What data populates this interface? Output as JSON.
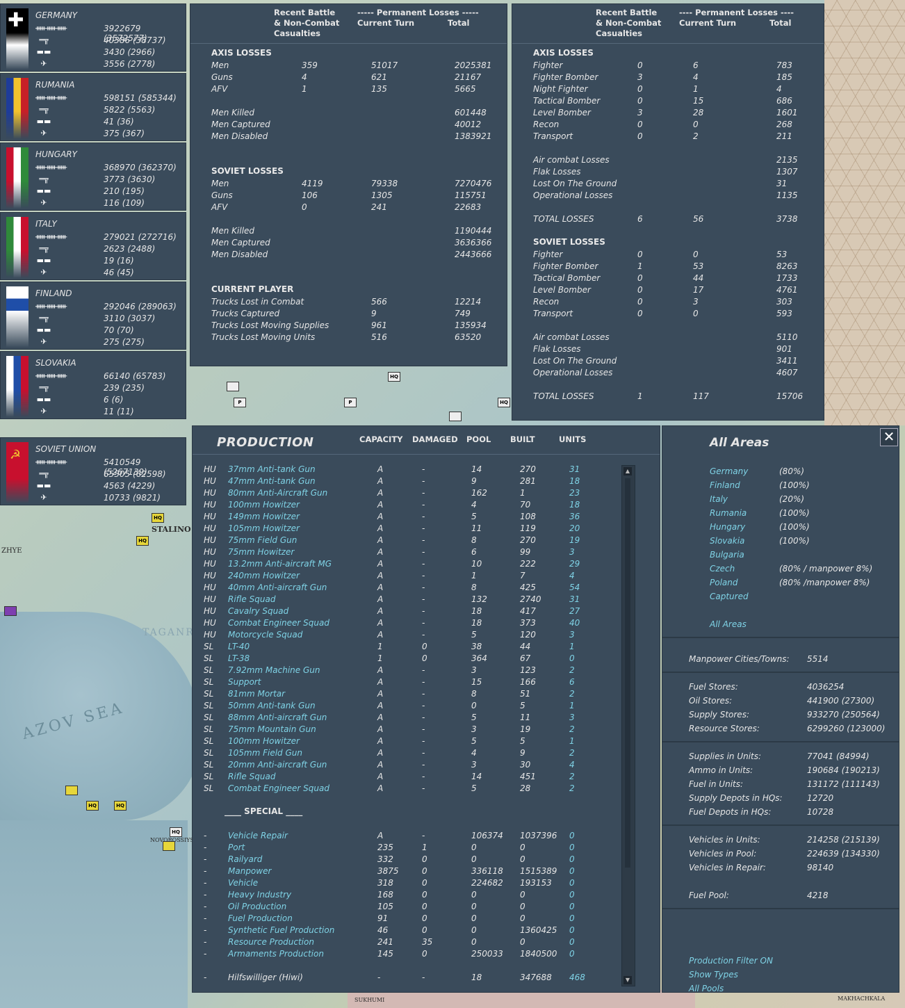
{
  "map": {
    "labels": [
      "STALINO",
      "ZHYE",
      "TAGANR",
      "NOVOROSSIYSK",
      "SUKHUMI",
      "MAKHACHKALA"
    ],
    "sea_label": "AZOV SEA",
    "unit_labels": [
      "HQ",
      "P",
      "P",
      "HQ",
      "HQ",
      "HQ",
      "HQ",
      "HQ",
      "HQ"
    ]
  },
  "nations": [
    {
      "name": "GERMANY",
      "men": "3922679 (3572577)",
      "guns": "40386 (38737)",
      "afv": "3430 (2966)",
      "air": "3556 (2778)",
      "colors": [
        "#000000",
        "#ffffff",
        "#000000"
      ]
    },
    {
      "name": "RUMANIA",
      "men": "598151 (585344)",
      "guns": "5822 (5563)",
      "afv": "41 (36)",
      "air": "375 (367)",
      "colors": [
        "#1e3c9a",
        "#f2c12e",
        "#c72027"
      ]
    },
    {
      "name": "HUNGARY",
      "men": "368970 (362370)",
      "guns": "3773 (3630)",
      "afv": "210 (195)",
      "air": "116 (109)",
      "colors": [
        "#c8102e",
        "#ffffff",
        "#2f8a3a"
      ]
    },
    {
      "name": "ITALY",
      "men": "279021 (272716)",
      "guns": "2623 (2488)",
      "afv": "19 (16)",
      "air": "46 (45)",
      "colors": [
        "#2f8a3a",
        "#ffffff",
        "#c8102e"
      ]
    },
    {
      "name": "FINLAND",
      "men": "292046 (289063)",
      "guns": "3110 (3037)",
      "afv": "70 (70)",
      "air": "275 (275)",
      "colors": [
        "#ffffff",
        "#1f4ea8",
        "#ffffff"
      ]
    },
    {
      "name": "SLOVAKIA",
      "men": "66140 (65783)",
      "guns": "239 (235)",
      "afv": "6 (6)",
      "air": "11 (11)",
      "colors": [
        "#ffffff",
        "#1f4ea8",
        "#c8102e"
      ]
    },
    {
      "name": "SOVIET UNION",
      "men": "5410549 (5267139)",
      "guns": "65505 (62598)",
      "afv": "4563 (4229)",
      "air": "10733 (9821)",
      "colors": [
        "#c8102e",
        "#c8102e",
        "#c8102e"
      ]
    }
  ],
  "ground_losses": {
    "head_recent": "Recent Battle\n& Non-Combat\nCasualties",
    "head_perm": "----- Permanent Losses -----",
    "head_turn": "Current Turn",
    "head_total": "Total",
    "axis_title": "AXIS LOSSES",
    "axis_rows": [
      {
        "label": "Men",
        "recent": "359",
        "turn": "51017",
        "total": "2025381"
      },
      {
        "label": "Guns",
        "recent": "4",
        "turn": "621",
        "total": "21167"
      },
      {
        "label": "AFV",
        "recent": "1",
        "turn": "135",
        "total": "5665"
      }
    ],
    "axis_men": [
      {
        "label": "Men Killed",
        "total": "601448"
      },
      {
        "label": "Men Captured",
        "total": "40012"
      },
      {
        "label": "Men Disabled",
        "total": "1383921"
      }
    ],
    "soviet_title": "SOVIET LOSSES",
    "soviet_rows": [
      {
        "label": "Men",
        "recent": "4119",
        "turn": "79338",
        "total": "7270476"
      },
      {
        "label": "Guns",
        "recent": "106",
        "turn": "1305",
        "total": "115751"
      },
      {
        "label": "AFV",
        "recent": "0",
        "turn": "241",
        "total": "22683"
      }
    ],
    "soviet_men": [
      {
        "label": "Men Killed",
        "total": "1190444"
      },
      {
        "label": "Men Captured",
        "total": "3636366"
      },
      {
        "label": "Men Disabled",
        "total": "2443666"
      }
    ],
    "player_title": "CURRENT PLAYER",
    "player_rows": [
      {
        "label": "Trucks Lost in Combat",
        "turn": "566",
        "total": "12214"
      },
      {
        "label": "Trucks Captured",
        "turn": "9",
        "total": "749"
      },
      {
        "label": "Trucks Lost Moving Supplies",
        "turn": "961",
        "total": "135934"
      },
      {
        "label": "Trucks Lost Moving Units",
        "turn": "516",
        "total": "63520"
      }
    ]
  },
  "air_losses": {
    "head_recent": "Recent Battle\n& Non-Combat\nCasualties",
    "head_perm": "---- Permanent Losses ----",
    "head_turn": "Current Turn",
    "head_total": "Total",
    "axis_title": "AXIS LOSSES",
    "axis_rows": [
      {
        "label": "Fighter",
        "recent": "0",
        "turn": "6",
        "total": "783"
      },
      {
        "label": "Fighter Bomber",
        "recent": "3",
        "turn": "4",
        "total": "185"
      },
      {
        "label": "Night Fighter",
        "recent": "0",
        "turn": "1",
        "total": "4"
      },
      {
        "label": "Tactical Bomber",
        "recent": "0",
        "turn": "15",
        "total": "686"
      },
      {
        "label": "Level Bomber",
        "recent": "3",
        "turn": "28",
        "total": "1601"
      },
      {
        "label": "Recon",
        "recent": "0",
        "turn": "0",
        "total": "268"
      },
      {
        "label": "Transport",
        "recent": "0",
        "turn": "2",
        "total": "211"
      }
    ],
    "axis_types": [
      {
        "label": "Air combat Losses",
        "total": "2135"
      },
      {
        "label": "Flak Losses",
        "total": "1307"
      },
      {
        "label": "Lost On The Ground",
        "total": "31"
      },
      {
        "label": "Operational Losses",
        "total": "1135"
      }
    ],
    "axis_total": {
      "label": "TOTAL LOSSES",
      "recent": "6",
      "turn": "56",
      "total": "3738"
    },
    "soviet_title": "SOVIET LOSSES",
    "soviet_rows": [
      {
        "label": "Fighter",
        "recent": "0",
        "turn": "0",
        "total": "53"
      },
      {
        "label": "Fighter Bomber",
        "recent": "1",
        "turn": "53",
        "total": "8263"
      },
      {
        "label": "Tactical Bomber",
        "recent": "0",
        "turn": "44",
        "total": "1733"
      },
      {
        "label": "Level Bomber",
        "recent": "0",
        "turn": "17",
        "total": "4761"
      },
      {
        "label": "Recon",
        "recent": "0",
        "turn": "3",
        "total": "303"
      },
      {
        "label": "Transport",
        "recent": "0",
        "turn": "0",
        "total": "593"
      }
    ],
    "soviet_types": [
      {
        "label": "Air combat Losses",
        "total": "5110"
      },
      {
        "label": "Flak Losses",
        "total": "901"
      },
      {
        "label": "Lost On The Ground",
        "total": "3411"
      },
      {
        "label": "Operational Losses",
        "total": "4607"
      }
    ],
    "soviet_total": {
      "label": "TOTAL LOSSES",
      "recent": "1",
      "turn": "117",
      "total": "15706"
    }
  },
  "production": {
    "title": "PRODUCTION",
    "columns": [
      "CAPACITY",
      "DAMAGED",
      "POOL",
      "BUILT",
      "UNITS"
    ],
    "rows": [
      [
        "HU",
        "37mm Anti-tank Gun",
        "A",
        "-",
        "14",
        "270",
        "31"
      ],
      [
        "HU",
        "47mm Anti-tank Gun",
        "A",
        "-",
        "9",
        "281",
        "18"
      ],
      [
        "HU",
        "80mm Anti-Aircraft Gun",
        "A",
        "-",
        "162",
        "1",
        "23"
      ],
      [
        "HU",
        "100mm Howitzer",
        "A",
        "-",
        "4",
        "70",
        "18"
      ],
      [
        "HU",
        "149mm Howitzer",
        "A",
        "-",
        "5",
        "108",
        "36"
      ],
      [
        "HU",
        "105mm Howitzer",
        "A",
        "-",
        "11",
        "119",
        "20"
      ],
      [
        "HU",
        "75mm Field Gun",
        "A",
        "-",
        "8",
        "270",
        "19"
      ],
      [
        "HU",
        "75mm Howitzer",
        "A",
        "-",
        "6",
        "99",
        "3"
      ],
      [
        "HU",
        "13.2mm Anti-aircraft MG",
        "A",
        "-",
        "10",
        "222",
        "29"
      ],
      [
        "HU",
        "240mm Howitzer",
        "A",
        "-",
        "1",
        "7",
        "4"
      ],
      [
        "HU",
        "40mm Anti-aircraft Gun",
        "A",
        "-",
        "8",
        "425",
        "54"
      ],
      [
        "HU",
        "Rifle Squad",
        "A",
        "-",
        "132",
        "2740",
        "31"
      ],
      [
        "HU",
        "Cavalry Squad",
        "A",
        "-",
        "18",
        "417",
        "27"
      ],
      [
        "HU",
        "Combat Engineer Squad",
        "A",
        "-",
        "18",
        "373",
        "40"
      ],
      [
        "HU",
        "Motorcycle Squad",
        "A",
        "-",
        "5",
        "120",
        "3"
      ],
      [
        "SL",
        "LT-40",
        "1",
        "0",
        "38",
        "44",
        "1"
      ],
      [
        "SL",
        "LT-38",
        "1",
        "0",
        "364",
        "67",
        "0"
      ],
      [
        "SL",
        "7.92mm Machine Gun",
        "A",
        "-",
        "3",
        "123",
        "2"
      ],
      [
        "SL",
        "Support",
        "A",
        "-",
        "15",
        "166",
        "6"
      ],
      [
        "SL",
        "81mm Mortar",
        "A",
        "-",
        "8",
        "51",
        "2"
      ],
      [
        "SL",
        "50mm Anti-tank Gun",
        "A",
        "-",
        "0",
        "5",
        "1"
      ],
      [
        "SL",
        "88mm Anti-aircraft Gun",
        "A",
        "-",
        "5",
        "11",
        "3"
      ],
      [
        "SL",
        "75mm Mountain Gun",
        "A",
        "-",
        "3",
        "19",
        "2"
      ],
      [
        "SL",
        "100mm Howitzer",
        "A",
        "-",
        "5",
        "5",
        "1"
      ],
      [
        "SL",
        "105mm Field Gun",
        "A",
        "-",
        "4",
        "9",
        "2"
      ],
      [
        "SL",
        "20mm Anti-aircraft Gun",
        "A",
        "-",
        "3",
        "30",
        "4"
      ],
      [
        "SL",
        "Rifle Squad",
        "A",
        "-",
        "14",
        "451",
        "2"
      ],
      [
        "SL",
        "Combat Engineer Squad",
        "A",
        "-",
        "5",
        "28",
        "2"
      ]
    ],
    "special_title": "____ SPECIAL ____",
    "special_rows": [
      [
        "-",
        "Vehicle Repair",
        "A",
        "-",
        "106374",
        "1037396",
        "0"
      ],
      [
        "-",
        "Port",
        "235",
        "1",
        "0",
        "0",
        "0"
      ],
      [
        "-",
        "Railyard",
        "332",
        "0",
        "0",
        "0",
        "0"
      ],
      [
        "-",
        "Manpower",
        "3875",
        "0",
        "336118",
        "1515389",
        "0"
      ],
      [
        "-",
        "Vehicle",
        "318",
        "0",
        "224682",
        "193153",
        "0"
      ],
      [
        "-",
        "Heavy Industry",
        "168",
        "0",
        "0",
        "0",
        "0"
      ],
      [
        "-",
        "Oil Production",
        "105",
        "0",
        "0",
        "0",
        "0"
      ],
      [
        "-",
        "Fuel Production",
        "91",
        "0",
        "0",
        "0",
        "0"
      ],
      [
        "-",
        "Synthetic Fuel Production",
        "46",
        "0",
        "0",
        "1360425",
        "0"
      ],
      [
        "-",
        "Resource Production",
        "241",
        "35",
        "0",
        "0",
        "0"
      ],
      [
        "-",
        "Armaments Production",
        "145",
        "0",
        "250033",
        "1840500",
        "0"
      ]
    ],
    "hiwi_row": [
      "-",
      "Hilfswilliger (Hiwi)",
      "-",
      "-",
      "18",
      "347688",
      "468"
    ]
  },
  "areas": {
    "title": "All Areas",
    "close_label": "✕",
    "countries": [
      {
        "name": "Germany",
        "pct": "(80%)"
      },
      {
        "name": "Finland",
        "pct": "(100%)"
      },
      {
        "name": "Italy",
        "pct": "(20%)"
      },
      {
        "name": "Rumania",
        "pct": "(100%)"
      },
      {
        "name": "Hungary",
        "pct": "(100%)"
      },
      {
        "name": "Slovakia",
        "pct": "(100%)"
      },
      {
        "name": "Bulgaria",
        "pct": ""
      },
      {
        "name": "Czech",
        "pct": "(80% / manpower 8%)"
      },
      {
        "name": "Poland",
        "pct": "(80% /manpower 8%)"
      },
      {
        "name": "Captured",
        "pct": ""
      }
    ],
    "all_areas_link": "All Areas",
    "manpower": {
      "label": "Manpower Cities/Towns:",
      "value": "5514"
    },
    "stores": [
      {
        "label": "Fuel Stores:",
        "value": "4036254"
      },
      {
        "label": "Oil Stores:",
        "value": "441900 (27300)"
      },
      {
        "label": "Supply Stores:",
        "value": "933270 (250564)"
      },
      {
        "label": "Resource Stores:",
        "value": "6299260 (123000)"
      }
    ],
    "units": [
      {
        "label": "Supplies in Units:",
        "value": "77041 (84994)"
      },
      {
        "label": "Ammo in Units:",
        "value": "190684 (190213)"
      },
      {
        "label": "Fuel in Units:",
        "value": "131172 (111143)"
      },
      {
        "label": "Supply Depots in HQs:",
        "value": "12720"
      },
      {
        "label": "Fuel Depots in HQs:",
        "value": "10728"
      }
    ],
    "vehicles": [
      {
        "label": "Vehicles in Units:",
        "value": "214258 (215139)"
      },
      {
        "label": "Vehicles in Pool:",
        "value": "224639 (134330)"
      },
      {
        "label": "Vehicles in Repair:",
        "value": "98140"
      }
    ],
    "fuel_pool": {
      "label": "Fuel Pool:",
      "value": "4218"
    },
    "links": [
      "Production Filter ON",
      "Show Types",
      "All Pools"
    ]
  }
}
